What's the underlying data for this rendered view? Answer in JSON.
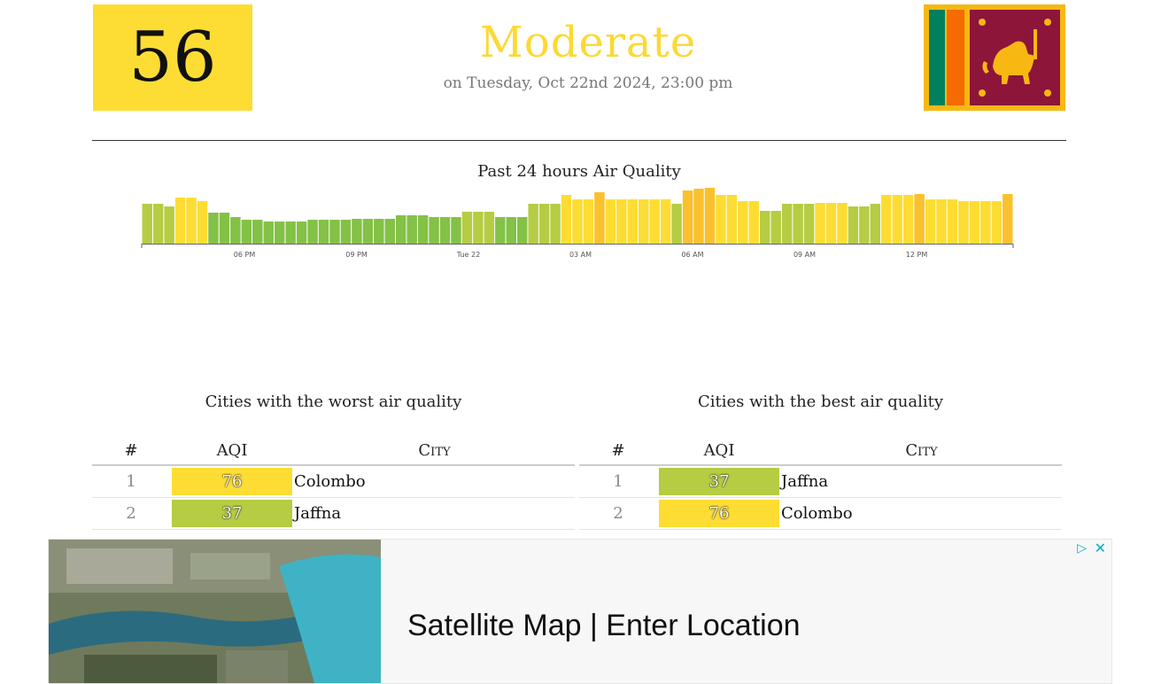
{
  "current": {
    "aqi": "56",
    "aqi_color": "#fddd33",
    "status": "Moderate",
    "status_color": "#fcd934",
    "datetime": "on Tuesday, Oct 22nd 2024, 23:00 pm"
  },
  "flag": {
    "icon": "sri-lanka-flag-icon"
  },
  "history": {
    "title": "Past 24 hours Air Quality"
  },
  "chart_data": {
    "type": "bar",
    "title": "Past 24 hours Air Quality",
    "x_tick_labels": [
      "06 PM",
      "09 PM",
      "Tue 22",
      "03 AM",
      "06 AM",
      "09 AM",
      "12 PM"
    ],
    "values": [
      45,
      45,
      42,
      52,
      52,
      48,
      35,
      35,
      30,
      27,
      27,
      25,
      25,
      25,
      25,
      27,
      27,
      27,
      27,
      28,
      28,
      28,
      28,
      32,
      32,
      32,
      30,
      30,
      30,
      36,
      36,
      36,
      30,
      30,
      30,
      45,
      45,
      45,
      55,
      50,
      50,
      58,
      50,
      50,
      50,
      50,
      50,
      50,
      45,
      60,
      62,
      63,
      55,
      55,
      48,
      48,
      37,
      37,
      45,
      45,
      45,
      46,
      46,
      46,
      42,
      42,
      45,
      55,
      55,
      55,
      56,
      50,
      50,
      50,
      48,
      48,
      48,
      48,
      56
    ],
    "colors_by_level": {
      "good": "#84c147",
      "lime": "#b5cc43",
      "yellow": "#fddd33",
      "amber": "#fbc02d"
    }
  },
  "worst": {
    "title": "Cities with the worst air quality",
    "headers": [
      "#",
      "AQI",
      "City"
    ],
    "rows": [
      {
        "rank": "1",
        "aqi": "76",
        "city": "Colombo",
        "color": "#fddd33"
      },
      {
        "rank": "2",
        "aqi": "37",
        "city": "Jaffna",
        "color": "#b5cc43"
      }
    ]
  },
  "best": {
    "title": "Cities with the best air quality",
    "headers": [
      "#",
      "AQI",
      "City"
    ],
    "rows": [
      {
        "rank": "1",
        "aqi": "37",
        "city": "Jaffna",
        "color": "#b5cc43"
      },
      {
        "rank": "2",
        "aqi": "76",
        "city": "Colombo",
        "color": "#fddd33"
      }
    ]
  },
  "ad": {
    "headline": "Satellite Map | Enter Location",
    "choices_icon": "ad-choices-icon",
    "close_icon": "close-icon"
  }
}
